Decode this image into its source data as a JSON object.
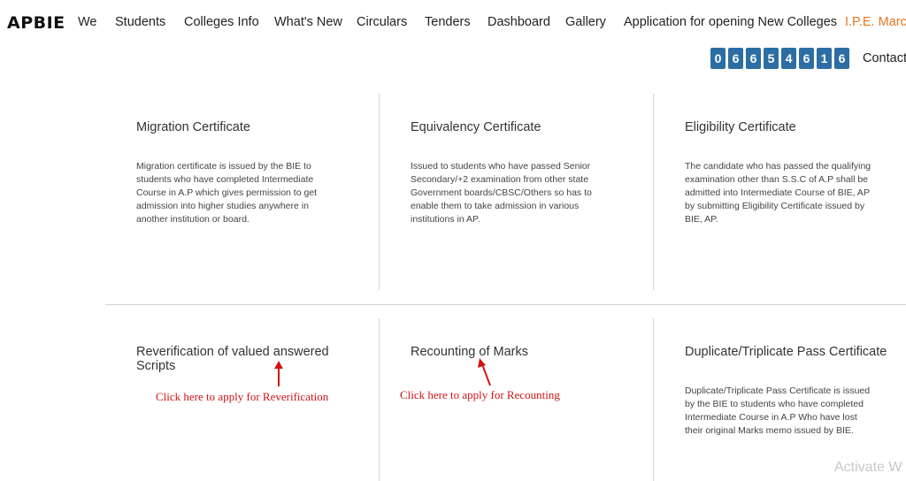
{
  "header": {
    "logo": "APBIE",
    "nav": [
      {
        "label": "We"
      },
      {
        "label": "Students"
      },
      {
        "label": "Colleges Info"
      },
      {
        "label": "What's New"
      },
      {
        "label": "Circulars"
      },
      {
        "label": "Tenders"
      },
      {
        "label": "Dashboard"
      },
      {
        "label": "Gallery"
      },
      {
        "label": "Application for opening New Colleges"
      },
      {
        "label": "I.P.E. March"
      }
    ],
    "visitor_counter": [
      "0",
      "6",
      "6",
      "5",
      "4",
      "6",
      "1",
      "6"
    ],
    "contact": "Contact"
  },
  "cards": [
    {
      "title": "Migration Certificate",
      "description": [
        "Migration certificate is issued by the BIE to",
        "students who have completed Intermediate",
        "Course in A.P which gives permission to get",
        "admission into higher studies anywhere in",
        "another institution or board."
      ]
    },
    {
      "title": "Equivalency Certificate",
      "description": [
        "Issued to students who have passed Senior",
        "Secondary/+2 examination from other state",
        "Government boards/CBSC/Others so has to",
        "enable them to take admission in various",
        "institutions in AP."
      ]
    },
    {
      "title": "Eligibility Certificate",
      "description": [
        "The candidate who has passed the qualifying",
        "examination other than S.S.C of A.P shall be",
        "admitted into Intermediate Course of BIE, AP",
        "by submitting Eligibility Certificate issued by",
        "BIE, AP."
      ]
    },
    {
      "title": [
        "Reverification of valued answered",
        "Scripts"
      ],
      "link": "Click here to apply for Reverification"
    },
    {
      "title": "Recounting of Marks",
      "link": "Click here to apply for Recounting"
    },
    {
      "title": "Duplicate/Triplicate Pass Certificate",
      "description": [
        "Duplicate/Triplicate Pass Certificate is issued",
        "by the BIE to students who have completed",
        "Intermediate Course in A.P Who have lost",
        "their original Marks memo issued by BIE."
      ]
    }
  ],
  "overlay": {
    "watermark": "Activate W"
  },
  "colors": {
    "accent": "#e87722",
    "counter_bg": "#2c6ea3",
    "annotation": "#d01414"
  }
}
